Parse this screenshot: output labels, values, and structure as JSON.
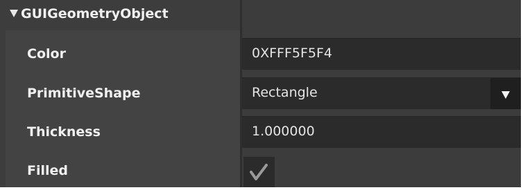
{
  "component": {
    "title": "GUIGeometryObject",
    "expand_icon": "triangle-down-icon"
  },
  "properties": {
    "color": {
      "label": "Color",
      "value": "0XFFF5F5F4"
    },
    "primitive_shape": {
      "label": "PrimitiveShape",
      "value": "Rectangle",
      "dropdown_icon": "triangle-down-icon"
    },
    "thickness": {
      "label": "Thickness",
      "value": "1.000000"
    },
    "filled": {
      "label": "Filled",
      "checked": true,
      "check_icon": "checkmark-icon"
    }
  },
  "colors": {
    "panel": "#3d3d3d",
    "label_column": "#434343",
    "field": "#2b2b2b",
    "text": "#f0f0f0",
    "checkmark": "#9a9a9a"
  }
}
